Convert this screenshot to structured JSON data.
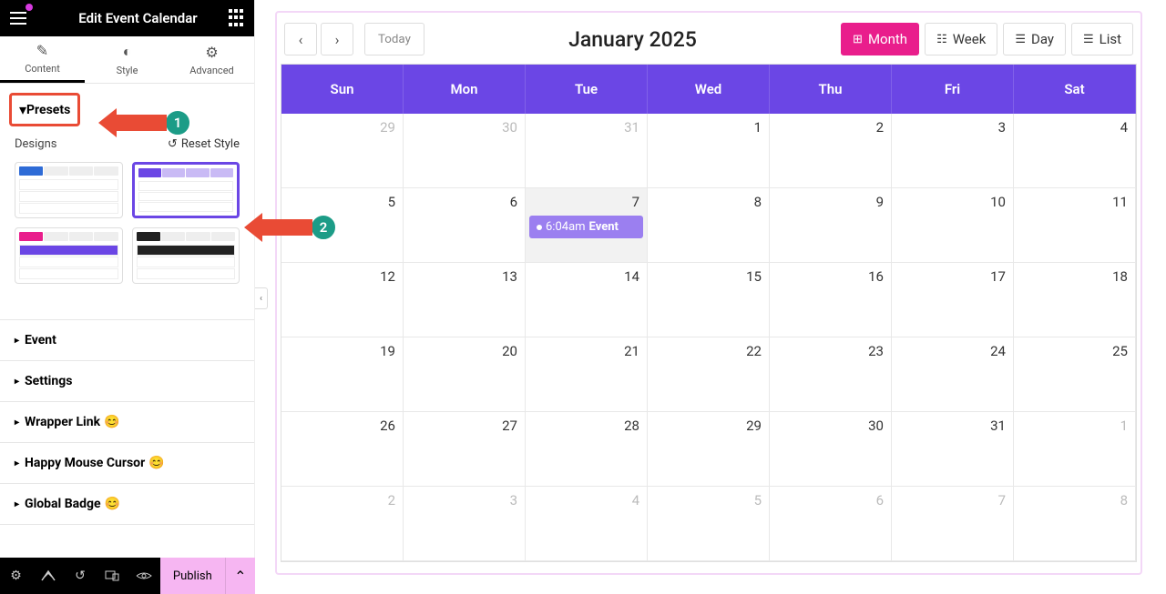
{
  "header": {
    "title": "Edit Event Calendar"
  },
  "tabs": {
    "content": "Content",
    "style": "Style",
    "advanced": "Advanced"
  },
  "presets": {
    "label": "Presets",
    "designs_label": "Designs",
    "reset": "Reset Style"
  },
  "sections": {
    "event": "Event",
    "settings": "Settings",
    "wrapper": "Wrapper Link",
    "cursor": "Happy Mouse Cursor",
    "badge": "Global Badge"
  },
  "arrows": {
    "one": "1",
    "two": "2"
  },
  "bottom": {
    "publish": "Publish"
  },
  "calendar": {
    "today": "Today",
    "title": "January 2025",
    "views": {
      "month": "Month",
      "week": "Week",
      "day": "Day",
      "list": "List"
    },
    "days": [
      "Sun",
      "Mon",
      "Tue",
      "Wed",
      "Thu",
      "Fri",
      "Sat"
    ],
    "cells": [
      {
        "n": "29",
        "other": true
      },
      {
        "n": "30",
        "other": true
      },
      {
        "n": "31",
        "other": true
      },
      {
        "n": "1"
      },
      {
        "n": "2"
      },
      {
        "n": "3"
      },
      {
        "n": "4"
      },
      {
        "n": "5"
      },
      {
        "n": "6"
      },
      {
        "n": "7",
        "today": true,
        "event": {
          "time": "6:04am",
          "title": "Event"
        }
      },
      {
        "n": "8"
      },
      {
        "n": "9"
      },
      {
        "n": "10"
      },
      {
        "n": "11"
      },
      {
        "n": "12"
      },
      {
        "n": "13"
      },
      {
        "n": "14"
      },
      {
        "n": "15"
      },
      {
        "n": "16"
      },
      {
        "n": "17"
      },
      {
        "n": "18"
      },
      {
        "n": "19"
      },
      {
        "n": "20"
      },
      {
        "n": "21"
      },
      {
        "n": "22"
      },
      {
        "n": "23"
      },
      {
        "n": "24"
      },
      {
        "n": "25"
      },
      {
        "n": "26"
      },
      {
        "n": "27"
      },
      {
        "n": "28"
      },
      {
        "n": "29"
      },
      {
        "n": "30"
      },
      {
        "n": "31"
      },
      {
        "n": "1",
        "other": true
      },
      {
        "n": "2",
        "other": true
      },
      {
        "n": "3",
        "other": true
      },
      {
        "n": "4",
        "other": true
      },
      {
        "n": "5",
        "other": true
      },
      {
        "n": "6",
        "other": true
      },
      {
        "n": "7",
        "other": true
      },
      {
        "n": "8",
        "other": true
      }
    ]
  }
}
